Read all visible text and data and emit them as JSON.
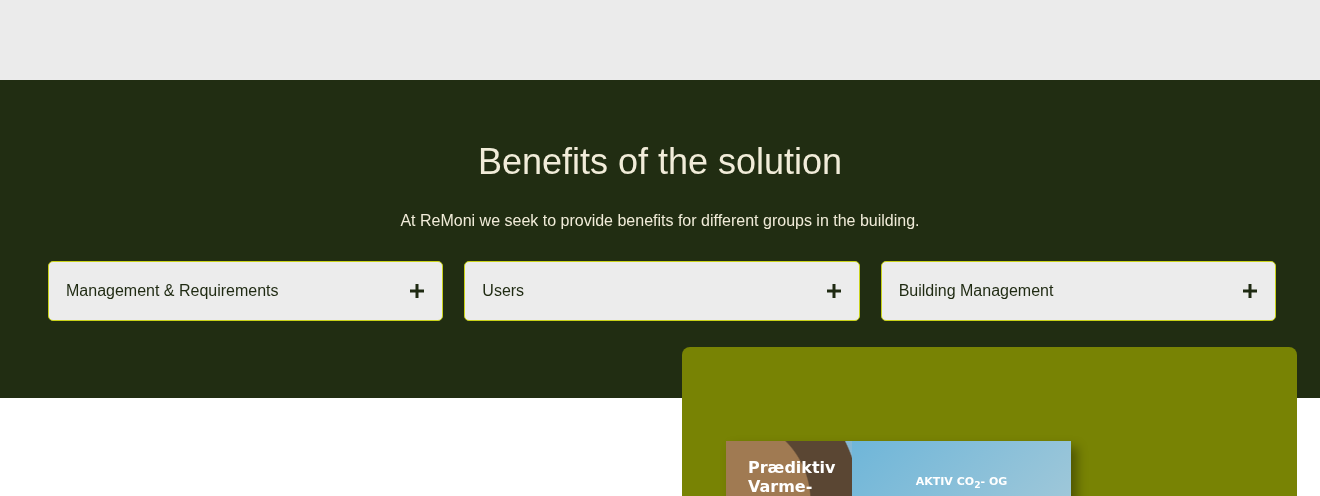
{
  "section": {
    "title": "Benefits of the solution",
    "subtitle": "At ReMoni we seek to provide benefits for different groups in the building."
  },
  "accordion": [
    {
      "label": "Management & Requirements",
      "expanded": false
    },
    {
      "label": "Users",
      "expanded": false
    },
    {
      "label": "Building Management",
      "expanded": false
    }
  ],
  "brochure": {
    "title": "Prædiktiv Varme-",
    "tagline": "AKTIV CO$_{2}$- OG"
  }
}
